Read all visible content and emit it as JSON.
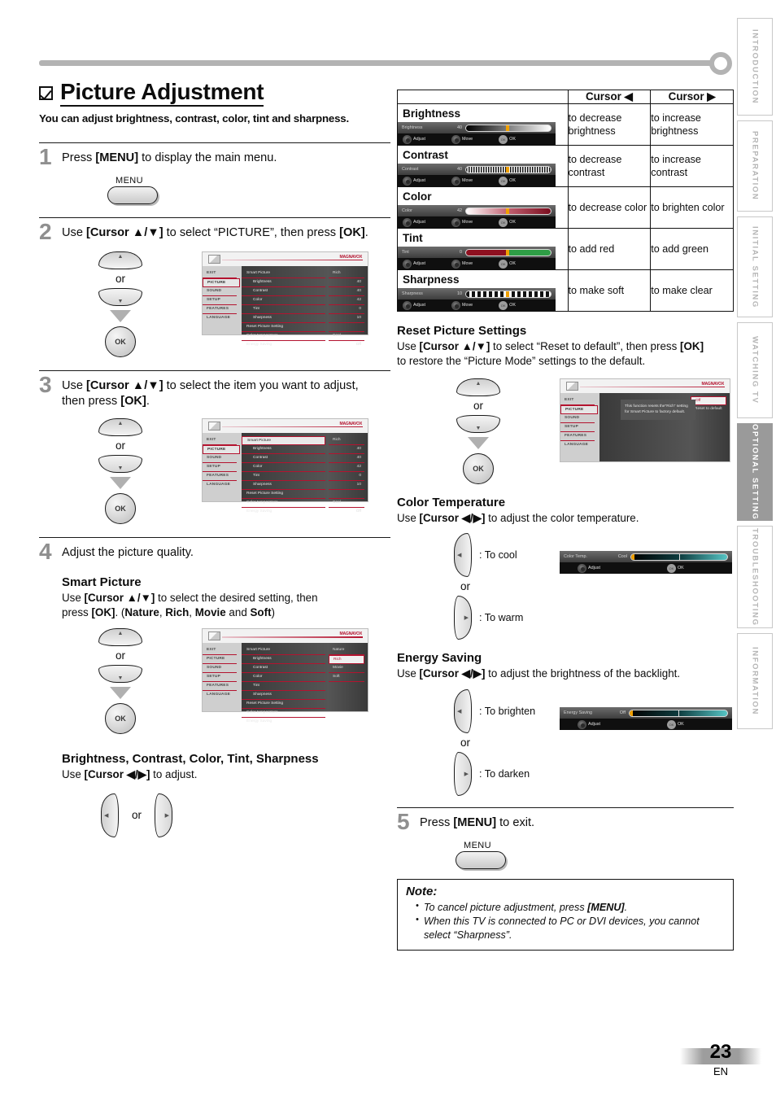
{
  "page": {
    "number": "23",
    "language": "EN"
  },
  "side_tabs": [
    {
      "label": "INTRODUCTION",
      "active": false
    },
    {
      "label": "PREPARATION",
      "active": false
    },
    {
      "label": "INITIAL  SETTING",
      "active": false
    },
    {
      "label": "WATCHING  TV",
      "active": false
    },
    {
      "label": "OPTIONAL  SETTING",
      "active": true
    },
    {
      "label": "TROUBLESHOOTING",
      "active": false
    },
    {
      "label": "INFORMATION",
      "active": false
    }
  ],
  "heading": {
    "title": "Picture Adjustment",
    "subtitle": "You can adjust brightness, contrast, color, tint and sharpness."
  },
  "steps": {
    "s1": {
      "num": "1",
      "text_a": "Press ",
      "bold_a": "[MENU]",
      "text_b": " to display the main menu."
    },
    "s2": {
      "num": "2",
      "text_a": "Use ",
      "bold_a": "[Cursor ▲/▼]",
      "text_b": " to select “PICTURE”, then press ",
      "bold_b": "[OK]",
      "text_c": "."
    },
    "s3": {
      "num": "3",
      "text_a": "Use ",
      "bold_a": "[Cursor ▲/▼]",
      "text_b": " to select the item you want to adjust, then press ",
      "bold_b": "[OK]",
      "text_c": "."
    },
    "s4": {
      "num": "4",
      "text_a": "Adjust the picture quality."
    },
    "s5": {
      "num": "5",
      "text_a": "Press ",
      "bold_a": "[MENU]",
      "text_b": " to exit."
    }
  },
  "buttons": {
    "menu_label": "MENU",
    "ok_label": "OK",
    "or_label": "or"
  },
  "smart_picture": {
    "heading": "Smart Picture",
    "line1_a": "Use ",
    "line1_b": "[Cursor ▲/▼]",
    "line1_c": " to select the desired setting, then",
    "line2_a": "press ",
    "line2_b": "[OK]",
    "line2_c": ". (",
    "opt1": "Nature",
    "sep1": ", ",
    "opt2": "Rich",
    "sep2": ", ",
    "opt3": "Movie",
    "sep3": " and ",
    "opt4": "Soft",
    "close": ")"
  },
  "bcct": {
    "heading": "Brightness, Contrast, Color, Tint, Sharpness",
    "line_a": "Use ",
    "line_b": "[Cursor ◀/▶]",
    "line_c": " to adjust."
  },
  "osd_menu": {
    "brand": "MAGNAVOX",
    "nav": [
      "EXIT",
      "PICTURE",
      "SOUND",
      "SETUP",
      "FEATURES",
      "LANGUAGE"
    ],
    "items": [
      "Smart Picture",
      "Brightness",
      "Contrast",
      "Color",
      "Tint",
      "Sharpness",
      "Reset Picture Setting",
      "Color temperature",
      "Energy Saving"
    ],
    "values": [
      "Rich",
      "40",
      "40",
      "42",
      "0",
      "10",
      "",
      "Cool",
      "Off"
    ],
    "smart_options": [
      "Nature",
      "Rich",
      "Movie",
      "Soft"
    ],
    "reset_msg": "This function resets the“Rich” setting for Smart Picture to factory default.",
    "reset_value_top": "Off",
    "reset_option": "Reset to default"
  },
  "table": {
    "header": {
      "blank": "",
      "cursor_left": "Cursor ◀",
      "cursor_right": "Cursor ▶"
    },
    "rows": [
      {
        "name": "Brightness",
        "bar_label": "Brightness",
        "bar_value": "40",
        "bar_type": "brightness",
        "left": "to decrease brightness",
        "right": "to increase brightness"
      },
      {
        "name": "Contrast",
        "bar_label": "Contrast",
        "bar_value": "40",
        "bar_type": "contrast",
        "left": "to decrease contrast",
        "right": "to increase contrast"
      },
      {
        "name": "Color",
        "bar_label": "Color",
        "bar_value": "42",
        "bar_type": "color",
        "left": "to decrease color",
        "right": "to brighten color"
      },
      {
        "name": "Tint",
        "bar_label": "Tint",
        "bar_value": "0",
        "bar_type": "tint",
        "left": "to add red",
        "right": "to add green"
      },
      {
        "name": "Sharpness",
        "bar_label": "Sharpness",
        "bar_value": "10",
        "bar_type": "sharpness",
        "left": "to make soft",
        "right": "to make clear"
      }
    ],
    "bar_controls": {
      "adjust": "Adjust",
      "move": "Move",
      "ok": "OK"
    }
  },
  "reset_section": {
    "heading": "Reset Picture Settings",
    "line1_a": "Use ",
    "line1_b": "[Cursor ▲/▼]",
    "line1_c": " to select “Reset to default”, then press ",
    "line1_d": "[OK]",
    "line2": "to restore the “Picture Mode” settings to the default."
  },
  "color_temp_section": {
    "heading": "Color Temperature",
    "line_a": "Use ",
    "line_b": "[Cursor ◀/▶]",
    "line_c": " to adjust the color temperature.",
    "left_key": ": To cool",
    "right_key": ": To warm",
    "bar_label": "Color Temp.",
    "bar_value": "Cool",
    "adjust": "Adjust",
    "ok": "OK"
  },
  "energy_section": {
    "heading": "Energy Saving",
    "line_a": "Use ",
    "line_b": "[Cursor ◀/▶]",
    "line_c": " to adjust the brightness of the backlight.",
    "left_key": ": To brighten",
    "right_key": ": To darken",
    "bar_label": "Energy Saving",
    "bar_value": "Off",
    "adjust": "Adjust",
    "ok": "OK"
  },
  "note": {
    "title": "Note:",
    "items": [
      {
        "a": "To cancel picture adjustment, press ",
        "b": "[MENU]",
        "c": "."
      },
      {
        "a": "When this TV is connected to PC or DVI devices, you cannot select “Sharpness”.",
        "b": "",
        "c": ""
      }
    ]
  },
  "colors": {
    "accent_red": "#b4132f",
    "tab_active": "#9a9a9a",
    "knob_orange": "#f0a000"
  }
}
